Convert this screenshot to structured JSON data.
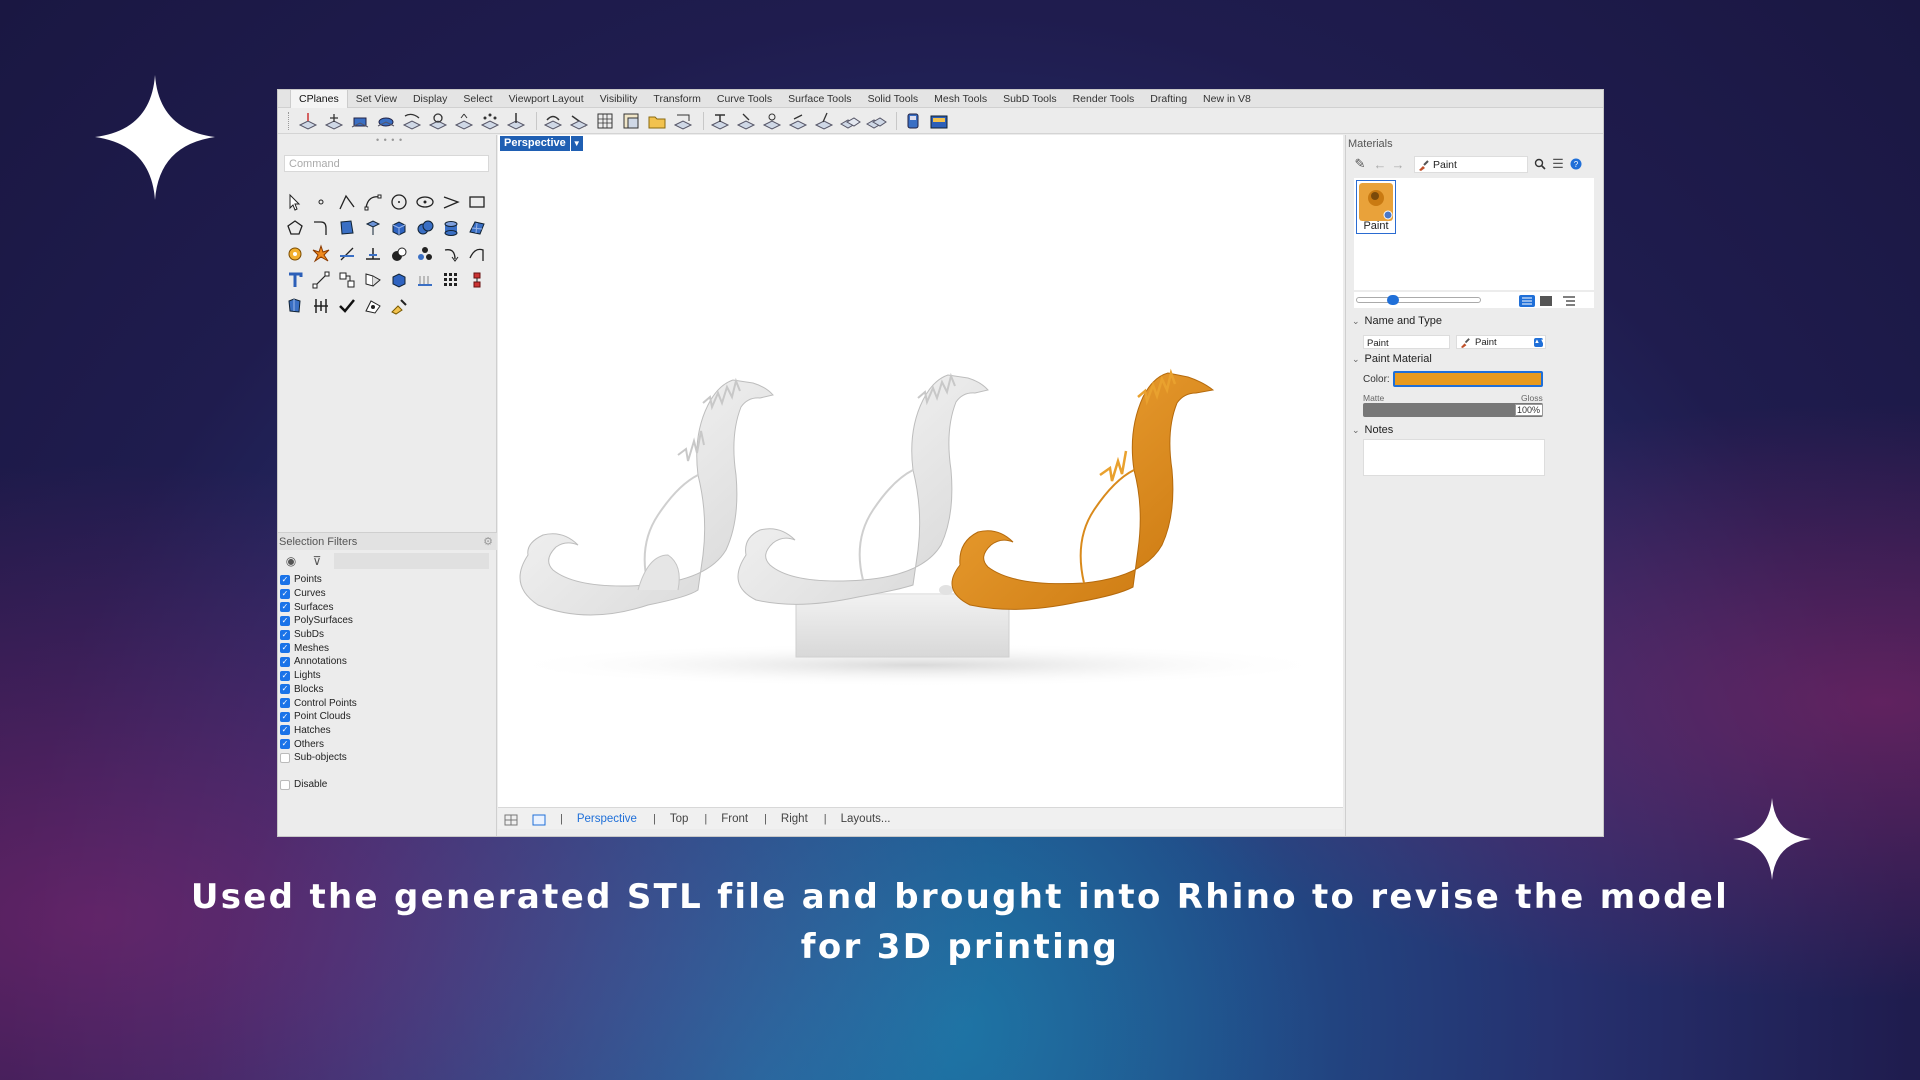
{
  "menu_tabs": [
    "CPlanes",
    "Set View",
    "Display",
    "Select",
    "Viewport Layout",
    "Visibility",
    "Transform",
    "Curve Tools",
    "Surface Tools",
    "Solid Tools",
    "Mesh Tools",
    "SubD Tools",
    "Render Tools",
    "Drafting",
    "New in V8"
  ],
  "command": {
    "placeholder": "Command"
  },
  "selection_filters": {
    "title": "Selection Filters",
    "items": [
      {
        "label": "Points",
        "checked": true
      },
      {
        "label": "Curves",
        "checked": true
      },
      {
        "label": "Surfaces",
        "checked": true
      },
      {
        "label": "PolySurfaces",
        "checked": true
      },
      {
        "label": "SubDs",
        "checked": true
      },
      {
        "label": "Meshes",
        "checked": true
      },
      {
        "label": "Annotations",
        "checked": true
      },
      {
        "label": "Lights",
        "checked": true
      },
      {
        "label": "Blocks",
        "checked": true
      },
      {
        "label": "Control Points",
        "checked": true
      },
      {
        "label": "Point Clouds",
        "checked": true
      },
      {
        "label": "Hatches",
        "checked": true
      },
      {
        "label": "Others",
        "checked": true
      },
      {
        "label": "Sub-objects",
        "checked": false
      }
    ],
    "disable_label": "Disable"
  },
  "viewport": {
    "name": "Perspective",
    "tabs": [
      "Perspective",
      "Top",
      "Front",
      "Right",
      "Layouts..."
    ],
    "active_tab": "Perspective",
    "model_colors": {
      "white": "#f3f3f3",
      "orange": "#e8941f"
    }
  },
  "materials": {
    "title": "Materials",
    "current": "Paint",
    "thumb_label": "Paint",
    "name_and_type": {
      "heading": "Name and Type",
      "name": "Paint",
      "type": "Paint"
    },
    "paint_material": {
      "heading": "Paint Material",
      "color_label": "Color:",
      "color": "#e89a1e",
      "matte_label": "Matte",
      "gloss_label": "Gloss",
      "gloss_value": "100%"
    },
    "notes_heading": "Notes"
  },
  "caption": "Used the generated STL file and brought into Rhino to revise the model for 3D printing"
}
